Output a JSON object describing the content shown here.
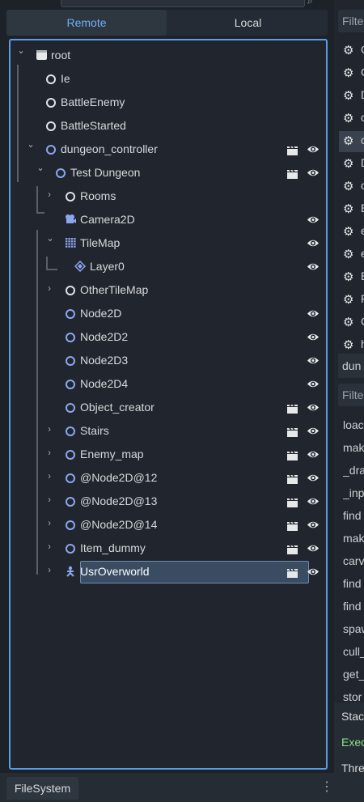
{
  "scene_tabs": {
    "remote": "Remote",
    "local": "Local"
  },
  "tree": {
    "nodes": [
      {
        "label": "root",
        "depth": 0,
        "arrow": "open",
        "icon": "scene-icon"
      },
      {
        "label": "Ie",
        "depth": 1,
        "icon": "node-ring-white-icon"
      },
      {
        "label": "BattleEnemy",
        "depth": 1,
        "icon": "node-ring-white-icon"
      },
      {
        "label": "BattleStarted",
        "depth": 1,
        "icon": "node-ring-white-icon"
      },
      {
        "label": "dungeon_controller",
        "depth": 1,
        "arrow": "open",
        "icon": "node2d-ring-icon",
        "clap": true,
        "eye": true
      },
      {
        "label": "Test Dungeon",
        "depth": 2,
        "arrow": "open",
        "icon": "node2d-ring-icon",
        "clap": true,
        "eye": true
      },
      {
        "label": "Rooms",
        "depth": 3,
        "arrow": "closed",
        "icon": "node-ring-white-icon"
      },
      {
        "label": "Camera2D",
        "depth": 3,
        "icon": "camera2d-icon",
        "eye": true
      },
      {
        "label": "TileMap",
        "depth": 3,
        "arrow": "open",
        "icon": "tilemap-icon",
        "eye": true
      },
      {
        "label": "Layer0",
        "depth": 4,
        "icon": "tilemap-layer-icon",
        "eye": true
      },
      {
        "label": "OtherTileMap",
        "depth": 3,
        "arrow": "closed",
        "icon": "node-ring-white-icon"
      },
      {
        "label": "Node2D",
        "depth": 3,
        "icon": "node2d-ring-icon",
        "eye": true
      },
      {
        "label": "Node2D2",
        "depth": 3,
        "icon": "node2d-ring-icon",
        "eye": true
      },
      {
        "label": "Node2D3",
        "depth": 3,
        "icon": "node2d-ring-icon",
        "eye": true
      },
      {
        "label": "Node2D4",
        "depth": 3,
        "icon": "node2d-ring-icon",
        "eye": true
      },
      {
        "label": "Object_creator",
        "depth": 3,
        "icon": "node2d-ring-icon",
        "clap": true,
        "eye": true
      },
      {
        "label": "Stairs",
        "depth": 3,
        "arrow": "closed",
        "icon": "node2d-ring-icon",
        "clap": true,
        "eye": true
      },
      {
        "label": "Enemy_map",
        "depth": 3,
        "arrow": "closed",
        "icon": "node2d-ring-icon",
        "clap": true,
        "eye": true
      },
      {
        "label": "@Node2D@12",
        "depth": 3,
        "arrow": "closed",
        "icon": "node2d-ring-icon",
        "clap": true,
        "eye": true
      },
      {
        "label": "@Node2D@13",
        "depth": 3,
        "arrow": "closed",
        "icon": "node2d-ring-icon",
        "clap": true,
        "eye": true
      },
      {
        "label": "@Node2D@14",
        "depth": 3,
        "arrow": "closed",
        "icon": "node2d-ring-icon",
        "clap": true,
        "eye": true
      },
      {
        "label": "Item_dummy",
        "depth": 3,
        "arrow": "closed",
        "icon": "node2d-ring-icon",
        "clap": true,
        "eye": true
      },
      {
        "label": "UsrOverworld",
        "depth": 3,
        "arrow": "closed",
        "icon": "character-body-icon",
        "clap": true,
        "eye": true,
        "selected": true
      }
    ]
  },
  "right_panel": {
    "filter1": "Filte",
    "gear_chars": [
      "C",
      "C",
      "D",
      "c",
      "c",
      "D",
      "c",
      "E",
      "e",
      "e",
      "E",
      "F",
      "C",
      "h"
    ],
    "selected_gear_index": 4,
    "dun_label": "dun",
    "filter2": "Filte",
    "methods": [
      "loac",
      "mak",
      "_dra",
      "_inp",
      "find",
      "mak",
      "carv",
      "find",
      "find",
      "spaw",
      "cull_",
      "get_",
      "stor"
    ],
    "stack_label": "Stac",
    "exec_label": "Exec",
    "thread_label": "Thre"
  },
  "bottom": {
    "filesystem_tab": "FileSystem"
  },
  "colors": {
    "accent": "#5c9be6",
    "node2d_blue": "#8da6f0",
    "exec_green": "#8be18b",
    "selection": "#3a4c61"
  }
}
